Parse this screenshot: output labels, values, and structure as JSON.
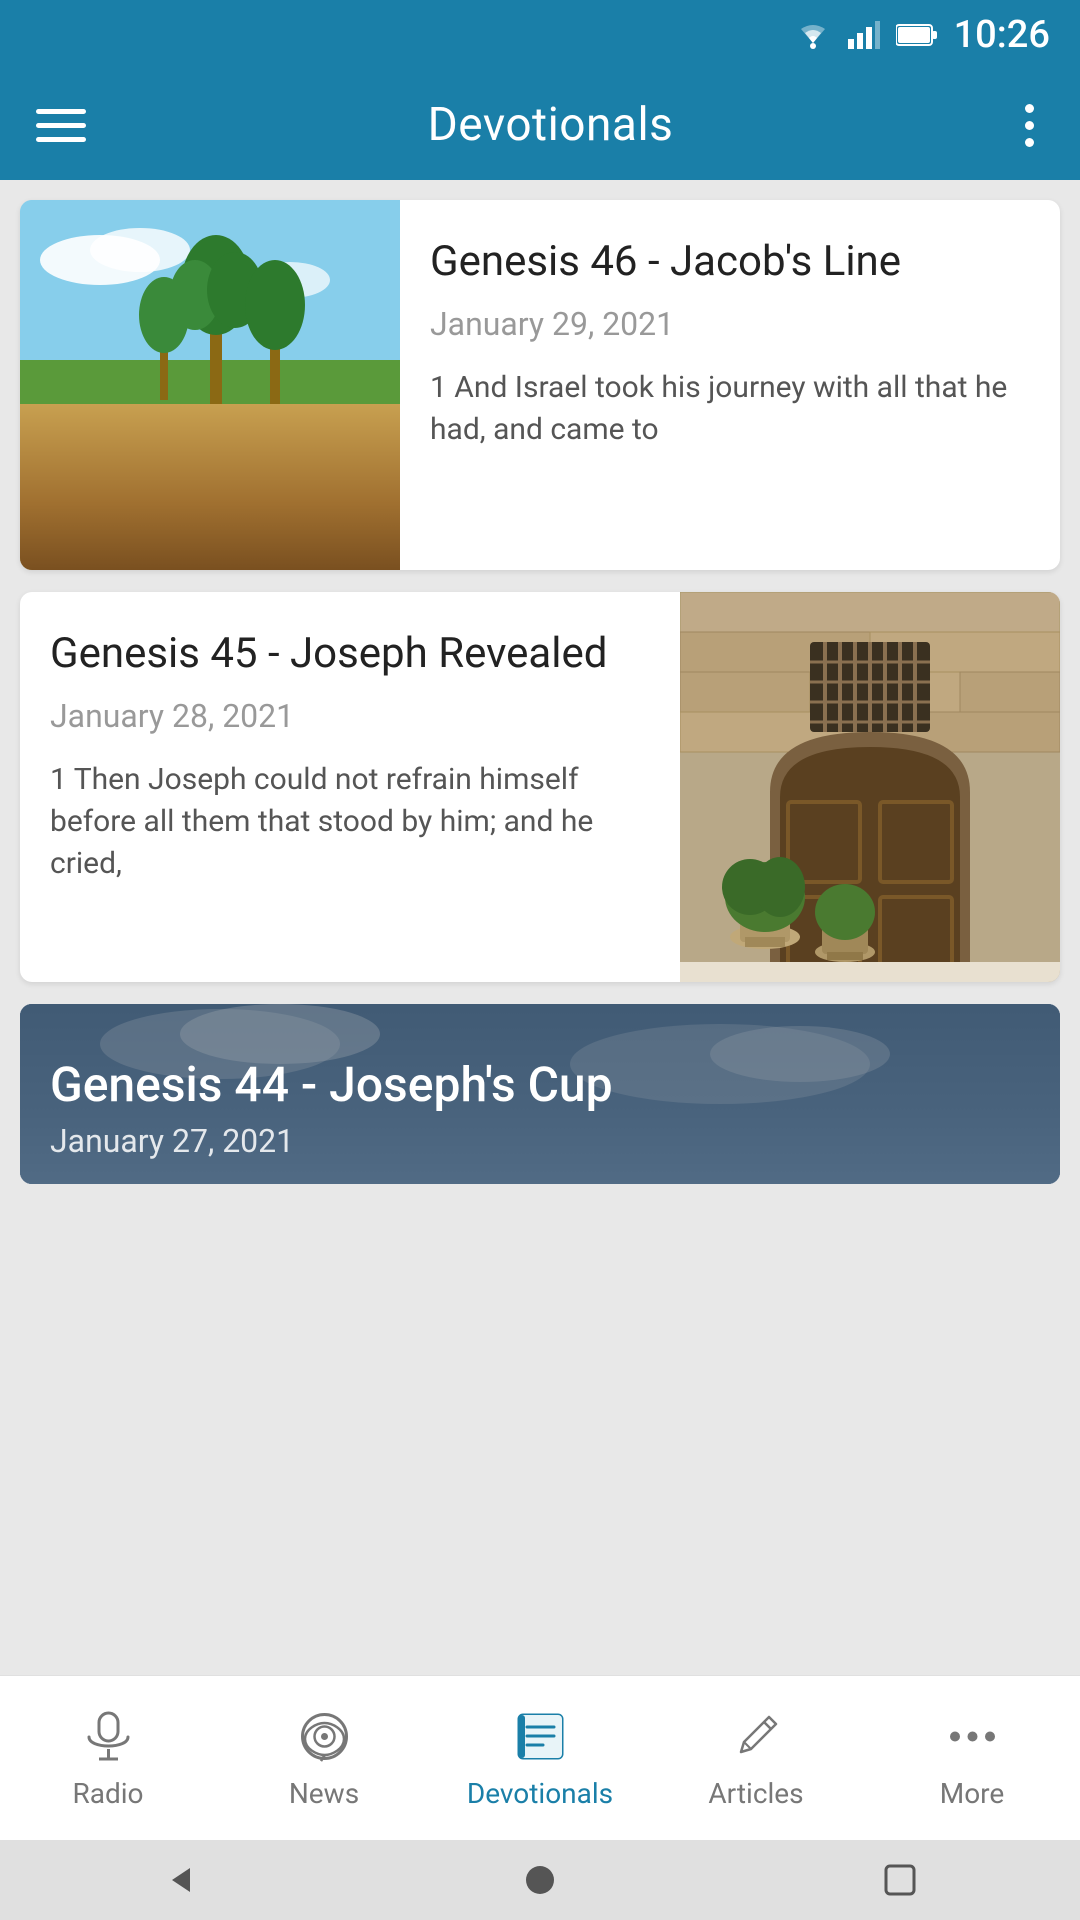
{
  "statusBar": {
    "time": "10:26"
  },
  "appBar": {
    "title": "Devotionals",
    "menuIcon": "menu-icon",
    "moreIcon": "more-vert-icon"
  },
  "cards": [
    {
      "id": "card-1",
      "title": "Genesis 46 - Jacob's Line",
      "date": "January 29, 2021",
      "excerpt": "1 And Israel took his journey with all that he had, and came to",
      "imagePosition": "left",
      "imageType": "camels"
    },
    {
      "id": "card-2",
      "title": "Genesis 45 - Joseph Revealed",
      "date": "January 28, 2021",
      "excerpt": "1 Then Joseph could not refrain himself before all them that stood by him; and he cried,",
      "imagePosition": "right",
      "imageType": "door"
    },
    {
      "id": "card-3",
      "title": "Genesis 44 - Joseph's Cup",
      "date": "January 27, 2021",
      "imagePosition": "full",
      "imageType": "sky"
    }
  ],
  "bottomNav": {
    "items": [
      {
        "id": "radio",
        "label": "Radio",
        "icon": "microphone-icon",
        "active": false
      },
      {
        "id": "news",
        "label": "News",
        "icon": "news-icon",
        "active": false
      },
      {
        "id": "devotionals",
        "label": "Devotionals",
        "icon": "devotionals-icon",
        "active": true
      },
      {
        "id": "articles",
        "label": "Articles",
        "icon": "articles-icon",
        "active": false
      },
      {
        "id": "more",
        "label": "More",
        "icon": "more-dots-icon",
        "active": false
      }
    ]
  }
}
